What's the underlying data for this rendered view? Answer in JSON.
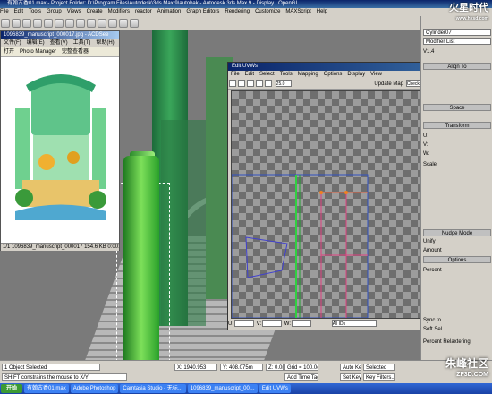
{
  "app": {
    "title": "有翰古香01.max  - Project Folder: D:\\Program Files\\Autodesk\\3ds Max 9\\autobak  - Autodesk 3ds Max 9  - Display : OpenGL",
    "menu": [
      "File",
      "Edit",
      "Tools",
      "Group",
      "Views",
      "Create",
      "Modifiers",
      "reactor",
      "Animation",
      "Graph Editors",
      "Rendering",
      "Customize",
      "MAXScript",
      "Help"
    ]
  },
  "viewer": {
    "title": "1096839_manuscript_000017.jpg - ACDSee",
    "menu": [
      "文件(F)",
      "编辑(E)",
      "查看(V)",
      "工具(T)",
      "帮助(H)"
    ],
    "tools": [
      "打开",
      "Photo Manager",
      "完整查看器"
    ],
    "status": "1/1   1096839_manuscript_000017   154.6 KB   0:00:00"
  },
  "uvw": {
    "title": "Edit UVWs",
    "menu": [
      "File",
      "Edit",
      "Select",
      "Tools",
      "Mapping",
      "Options",
      "Display",
      "View"
    ],
    "tool_value": "25.0",
    "update_map": "Update Map",
    "checker": "CheckerPattern",
    "bottom_u": "U:",
    "bottom_v": "V:",
    "bottom_w": "W:",
    "ids": "All IDs"
  },
  "cmd": {
    "object_name": "Cylinder07",
    "modifier_list": "Modifier List",
    "rollouts": [
      "Align To",
      "Space",
      "Transform",
      "Nudge Mode",
      "Options"
    ],
    "labels": [
      "V1.4",
      "U:",
      "V:",
      "W:",
      "Scale",
      "Unify",
      "Amount",
      "Percent",
      "Sync to",
      "Soft Sel"
    ]
  },
  "status": {
    "selected": "1 Object Selected",
    "prompt": "SHIFT constrains the mouse to X/Y",
    "x": "X: 1940.953",
    "y": "Y: 408.075m",
    "z": "Z: 0.0mm",
    "grid": "Grid = 100.0cm",
    "time_tag": "Add Time Tag",
    "auto_key": "Auto Key",
    "set_key": "Set Key",
    "selected_dd": "Selected",
    "key_filters": "Key Filters...",
    "percent_relax": "Percent Relaxtering"
  },
  "taskbar": {
    "start": "开始",
    "tasks": [
      "有翰古香01.max",
      "Adobe Photoshop",
      "Camtasia Studio - 无标…",
      "1096839_manuscript_00…",
      "Edit UVWs"
    ]
  },
  "watermark": {
    "top": "火星时代",
    "top_url": "www.hxsd.com",
    "bottom": "朱峰社区",
    "bottom_url": "ZF3D.COM"
  }
}
